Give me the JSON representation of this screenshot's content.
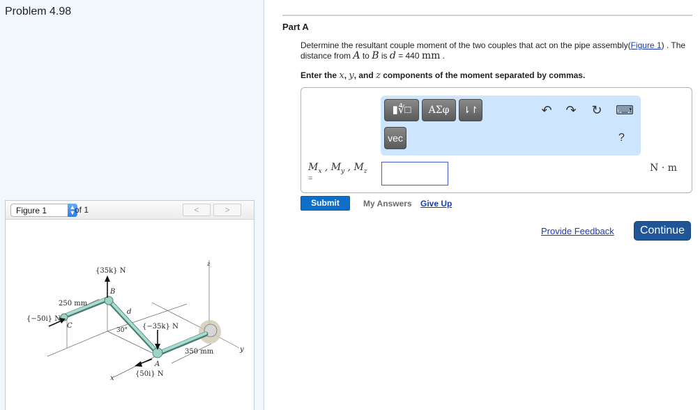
{
  "problem": {
    "title": "Problem 4.98"
  },
  "figure_panel": {
    "selected_figure": "Figure 1",
    "of_label": "of 1",
    "prev_icon": "chevron-left-icon",
    "next_icon": "chevron-right-icon",
    "prev_glyph": "<",
    "next_glyph": ">",
    "labels": {
      "force_b": "{35k} N",
      "point_b": "B",
      "dim_250": "250 mm",
      "force_c": "{−50i} N",
      "point_c": "C",
      "dist_d": "d",
      "angle": "30°",
      "force_a_down": "{−35k} N",
      "dim_350": "350 mm",
      "point_a": "A",
      "force_a_x": "{50i} N",
      "axis_x": "x",
      "axis_y": "y",
      "axis_z": "z"
    }
  },
  "part": {
    "title": "Part A",
    "prompt_1": "Determine the resultant couple moment of the two couples that act on the pipe assembly",
    "figure_link_open": "(",
    "figure_link": "Figure 1",
    "prompt_2": ") . The distance from ",
    "var_a": "A",
    "prompt_3": " to ",
    "var_b": "B",
    "prompt_4": " is ",
    "var_d": "d",
    "prompt_5": " = 440 ",
    "unit_mm": "mm",
    "prompt_6": " .",
    "instr_1": "Enter the ",
    "instr_x": "x",
    "instr_2": ", ",
    "instr_y": "y",
    "instr_3": ", and ",
    "instr_z": "z",
    "instr_4": " components of the moment separated by commas."
  },
  "answer": {
    "toolbar": {
      "templates_label": "▮∜□",
      "greek_label": "ΑΣφ",
      "arrows_label": "⇂↾",
      "vec_label": "vec",
      "undo_glyph": "↶",
      "redo_glyph": "↷",
      "reset_glyph": "↻",
      "keyboard_glyph": "⌨",
      "help_label": "?"
    },
    "variable_label": "Mx , My , Mz",
    "equals": "=",
    "input_value": "",
    "units": "N · m"
  },
  "actions": {
    "submit": "Submit",
    "my_answers": "My Answers",
    "give_up": "Give Up",
    "feedback": "Provide Feedback",
    "continue": "Continue"
  }
}
